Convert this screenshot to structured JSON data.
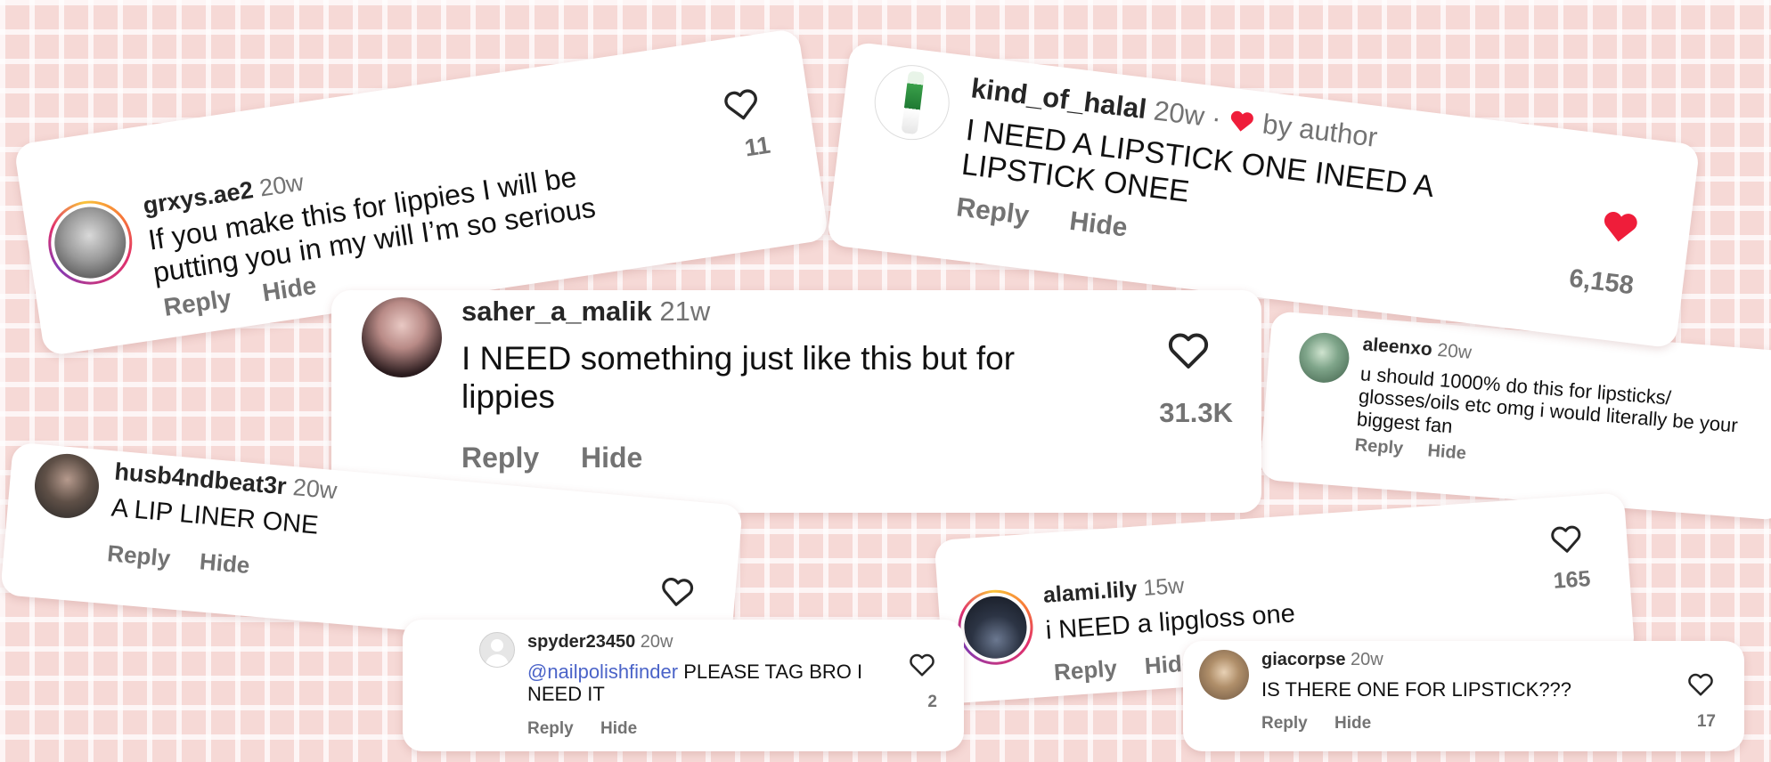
{
  "comments": [
    {
      "username": "grxys.ae2",
      "time": "20w",
      "text": "If you make this for lippies I will be putting you in my will I’m so serious",
      "reply": "Reply",
      "hide": "Hide",
      "likes": "11",
      "liked": false
    },
    {
      "username": "kind_of_halal",
      "time": "20w ·",
      "by_author": "by author",
      "text": "I NEED A LIPSTICK ONE INEED A LIPSTICK ONEE",
      "reply": "Reply",
      "hide": "Hide",
      "likes": "6,158",
      "liked": true
    },
    {
      "username": "saher_a_malik",
      "time": "21w",
      "text": "I NEED something just like this but for lippies",
      "reply": "Reply",
      "hide": "Hide",
      "likes": "31.3K",
      "liked": false
    },
    {
      "username": "aleenxo",
      "time": "20w",
      "text": "u should 1000% do this for lipsticks/ glosses/oils etc omg i would literally be your biggest fan",
      "reply": "Reply",
      "hide": "Hide",
      "likes": "",
      "liked": false
    },
    {
      "username": "husb4ndbeat3r",
      "time": "20w",
      "text": "A LIP LINER ONE",
      "reply": "Reply",
      "hide": "Hide",
      "likes": "",
      "liked": false
    },
    {
      "username": "spyder23450",
      "time": "20w",
      "mention": "@nailpolishfinder",
      "text": " PLEASE TAG BRO I NEED IT",
      "reply": "Reply",
      "hide": "Hide",
      "likes": "2",
      "liked": false
    },
    {
      "username": "alami.lily",
      "time": "15w",
      "text": "i NEED a lipgloss one",
      "reply": "Reply",
      "hide": "Hide",
      "likes": "165",
      "liked": false
    },
    {
      "username": "giacorpse",
      "time": "20w",
      "text": "IS THERE ONE FOR LIPSTICK???",
      "reply": "Reply",
      "hide": "Hide",
      "likes": "17",
      "liked": false
    }
  ],
  "colors": {
    "background": "#f6d9d6",
    "liked_heart": "#ef1d3a",
    "mention": "#4a63c8"
  },
  "icons": {
    "like": "heart-outline-icon",
    "liked": "heart-filled-icon"
  }
}
